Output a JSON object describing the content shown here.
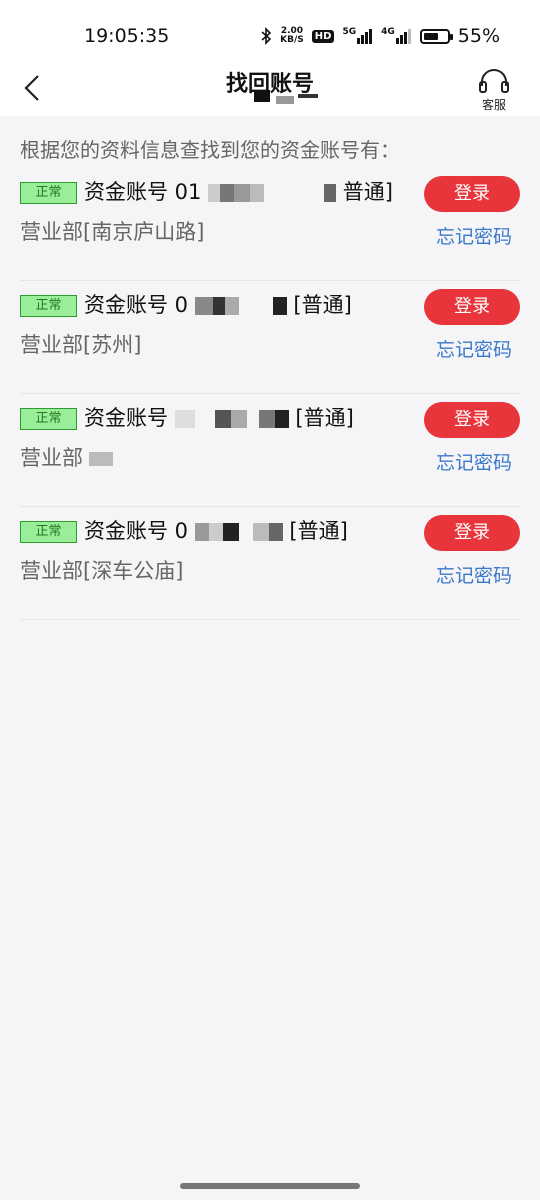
{
  "status_bar": {
    "time": "19:05:35",
    "net_speed_value": "2.00",
    "net_speed_unit": "KB/S",
    "hd_label": "HD",
    "sig1_label": "5G",
    "sig2_label": "4G",
    "battery": "55%",
    "battery_level": 0.55
  },
  "nav": {
    "title": "找回账号",
    "service_label": "客服"
  },
  "intro_text": "根据您的资料信息查找到您的资金账号有：",
  "accounts": [
    {
      "status": "正常",
      "prefix": "资金账号 01",
      "suffix": "普通]",
      "branch": "营业部[南京庐山路]",
      "login": "登录",
      "forgot": "忘记密码"
    },
    {
      "status": "正常",
      "prefix": "资金账号 0",
      "suffix": "[普通]",
      "branch": "营业部[苏州]",
      "login": "登录",
      "forgot": "忘记密码"
    },
    {
      "status": "正常",
      "prefix": "资金账号",
      "suffix": "[普通]",
      "branch": "营业部",
      "login": "登录",
      "forgot": "忘记密码"
    },
    {
      "status": "正常",
      "prefix": "资金账号 0",
      "suffix": "[普通]",
      "branch": "营业部[深车公庙]",
      "login": "登录",
      "forgot": "忘记密码"
    }
  ],
  "colors": {
    "primary_red": "#e8343b",
    "link_blue": "#3a78c9",
    "status_green": "#9aee9a"
  }
}
